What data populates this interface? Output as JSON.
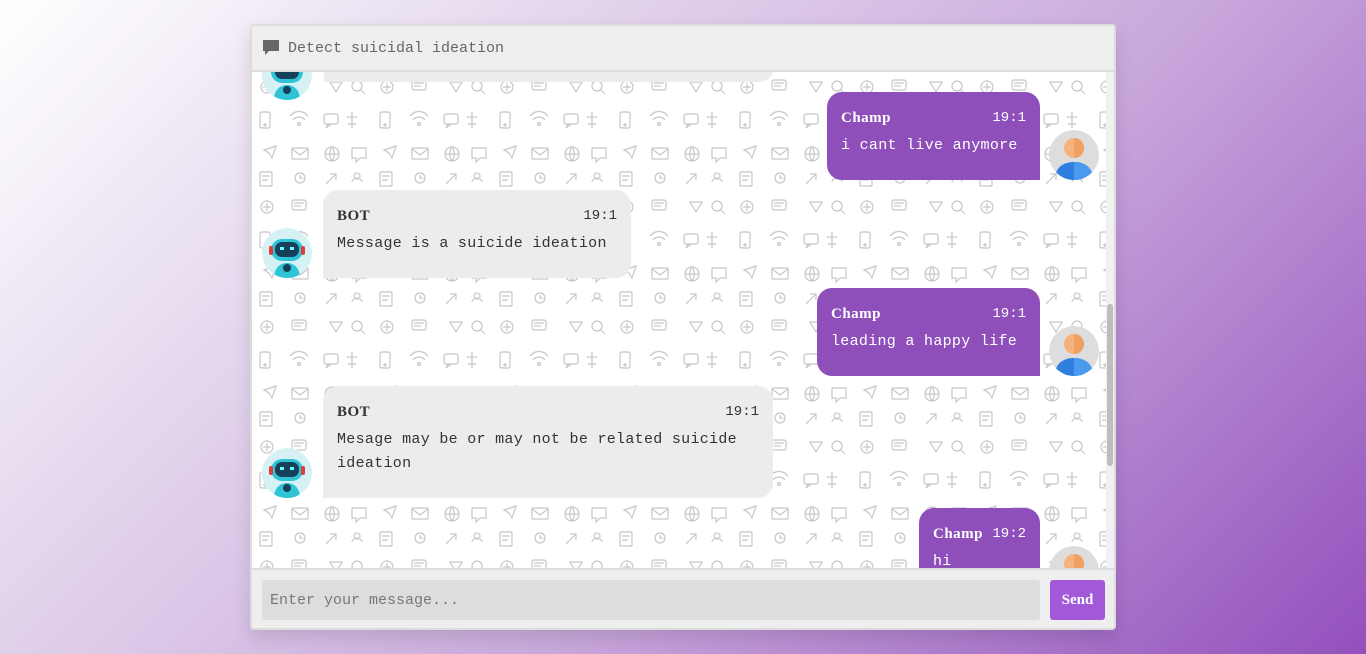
{
  "header": {
    "title": "Detect suicidal ideation",
    "icon": "chat-bubble-icon"
  },
  "messages": [
    {
      "sender": "Champ",
      "time": "19:1",
      "text": "i cant live anymore",
      "side": "right"
    },
    {
      "sender": "BOT",
      "time": "19:1",
      "text": "Message is a suicide ideation",
      "side": "left"
    },
    {
      "sender": "Champ",
      "time": "19:1",
      "text": "leading a happy life",
      "side": "right"
    },
    {
      "sender": "BOT",
      "time": "19:1",
      "text": "Mesage may be or may not be related suicide ideation",
      "side": "left"
    },
    {
      "sender": "Champ",
      "time": "19:2",
      "text": "hi",
      "side": "right"
    }
  ],
  "input": {
    "placeholder": "Enter your message...",
    "value": ""
  },
  "send_label": "Send",
  "colors": {
    "user_bubble": "#8e4fbb",
    "bot_bubble": "#ececec",
    "send_button": "#a259d9"
  }
}
